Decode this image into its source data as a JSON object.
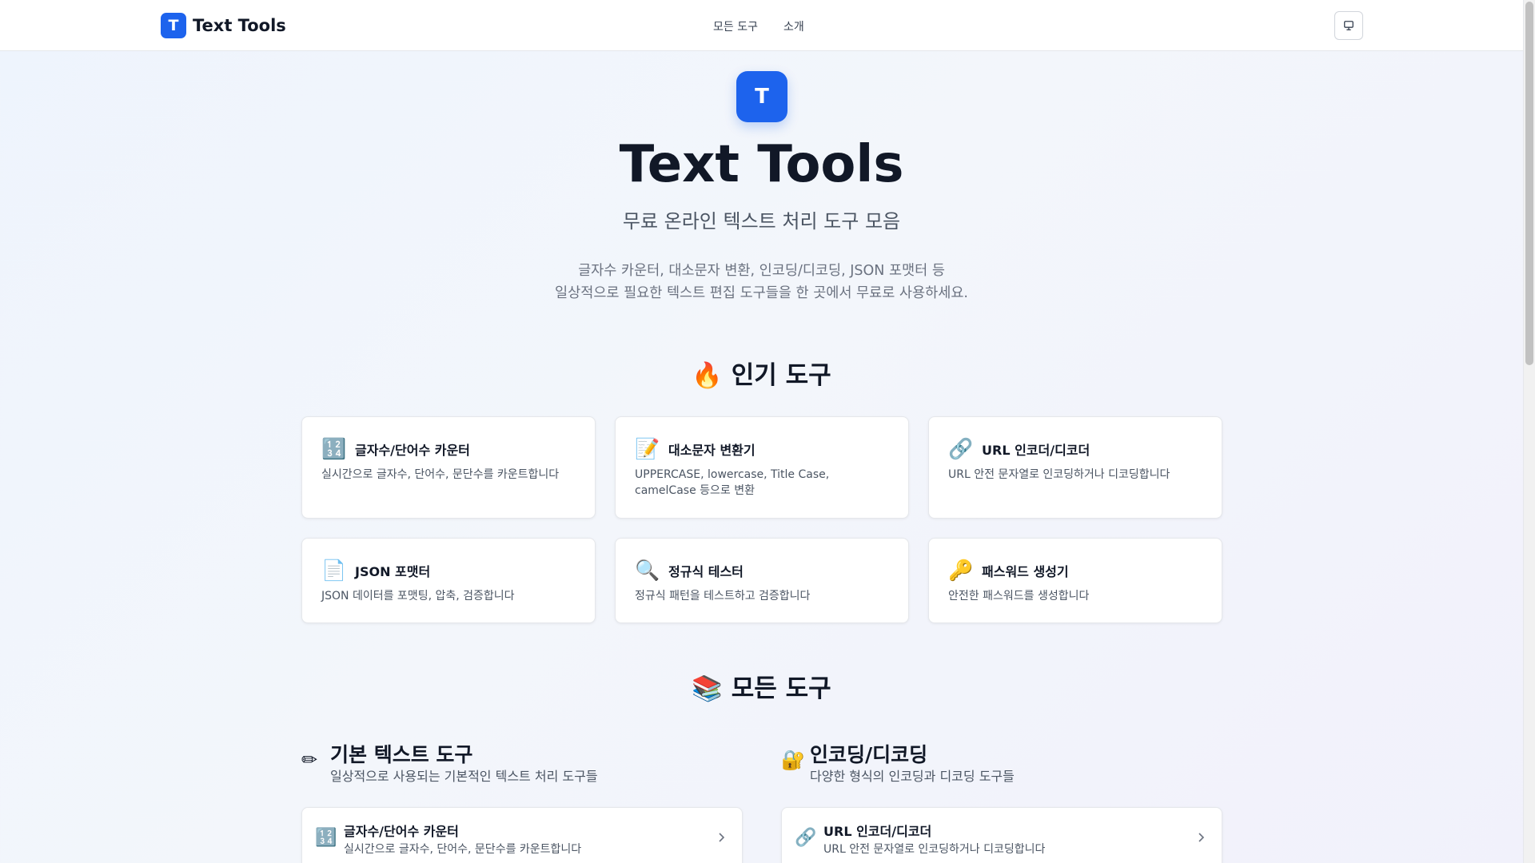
{
  "header": {
    "brand_logo_letter": "T",
    "brand_name": "Text Tools",
    "nav": [
      {
        "label": "모든 도구"
      },
      {
        "label": "소개"
      }
    ],
    "theme_button_icon": "monitor-icon"
  },
  "hero": {
    "logo_letter": "T",
    "title": "Text Tools",
    "subtitle": "무료 온라인 텍스트 처리 도구 모음",
    "description_line1": "글자수 카운터, 대소문자 변환, 인코딩/디코딩, JSON 포맷터 등",
    "description_line2": "일상적으로 필요한 텍스트 편집 도구들을 한 곳에서 무료로 사용하세요."
  },
  "popular": {
    "icon": "🔥",
    "title": "인기 도구",
    "cards": [
      {
        "icon": "🔢",
        "title": "글자수/단어수 카운터",
        "desc": "실시간으로 글자수, 단어수, 문단수를 카운트합니다"
      },
      {
        "icon": "📝",
        "title": "대소문자 변환기",
        "desc": "UPPERCASE, lowercase, Title Case, camelCase 등으로 변환"
      },
      {
        "icon": "🔗",
        "title": "URL 인코더/디코더",
        "desc": "URL 안전 문자열로 인코딩하거나 디코딩합니다"
      },
      {
        "icon": "📄",
        "title": "JSON 포맷터",
        "desc": "JSON 데이터를 포맷팅, 압축, 검증합니다"
      },
      {
        "icon": "🔍",
        "title": "정규식 테스터",
        "desc": "정규식 패턴을 테스트하고 검증합니다"
      },
      {
        "icon": "🔑",
        "title": "패스워드 생성기",
        "desc": "안전한 패스워드를 생성합니다"
      }
    ]
  },
  "all_tools": {
    "icon": "📚",
    "title": "모든 도구",
    "categories": [
      {
        "icon": "✏",
        "title": "기본 텍스트 도구",
        "desc": "일상적으로 사용되는 기본적인 텍스트 처리 도구들",
        "items": [
          {
            "icon": "🔢",
            "title": "글자수/단어수 카운터",
            "desc": "실시간으로 글자수, 단어수, 문단수를 카운트합니다"
          }
        ]
      },
      {
        "icon": "🔐",
        "title": "인코딩/디코딩",
        "desc": "다양한 형식의 인코딩과 디코딩 도구들",
        "items": [
          {
            "icon": "🔗",
            "title": "URL 인코더/디코더",
            "desc": "URL 안전 문자열로 인코딩하거나 디코딩합니다"
          }
        ]
      }
    ]
  }
}
